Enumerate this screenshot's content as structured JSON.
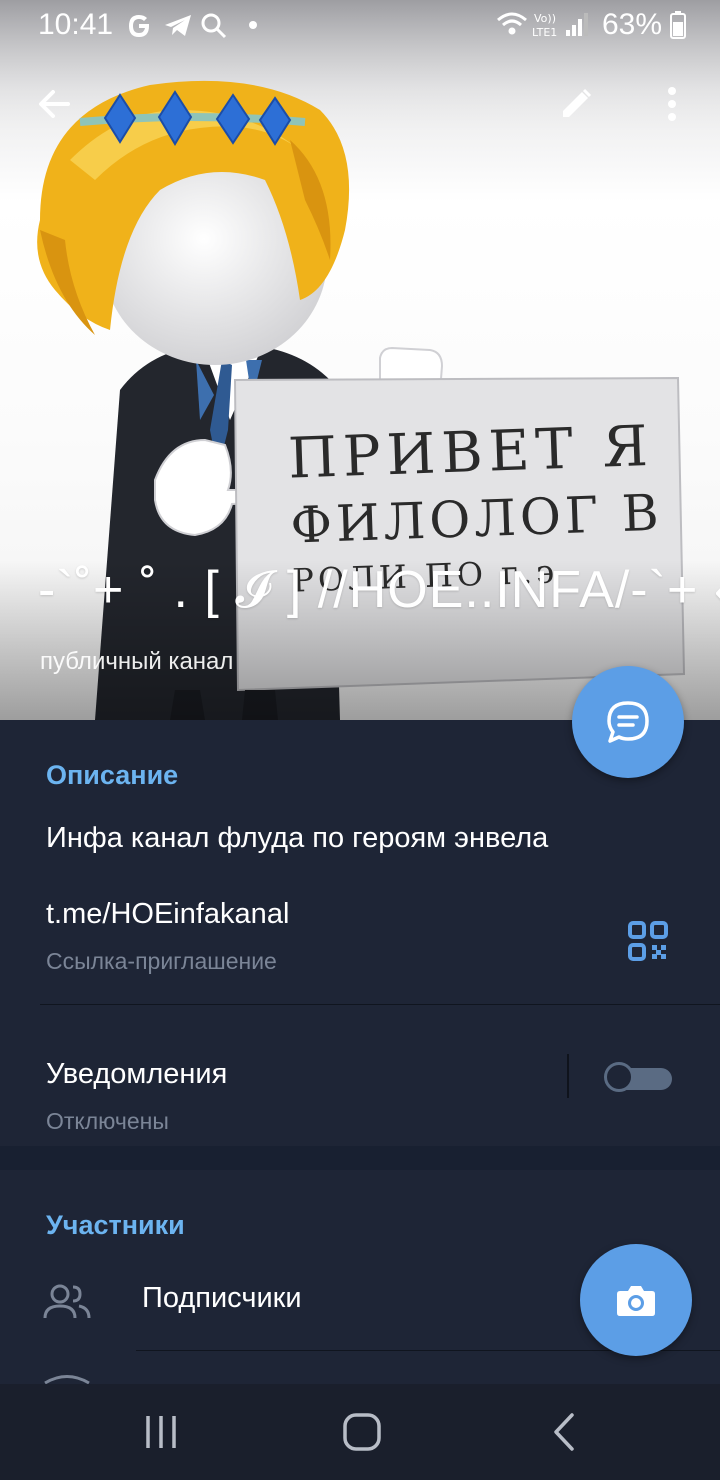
{
  "status_bar": {
    "time": "10:41",
    "battery": "63%",
    "left_icons": [
      "google-icon",
      "telegram-icon",
      "search-icon",
      "dot-icon"
    ],
    "right_icons": [
      "wifi-icon",
      "volte-icon",
      "signal-icon",
      "battery-icon"
    ]
  },
  "header": {
    "back_icon": "arrow-left-icon",
    "edit_icon": "pencil-icon",
    "more_icon": "more-vertical-icon",
    "channel_name": "-`˚+ ˚ . [ 𝓘 ] //HOE..INFA/-`+ ‹",
    "channel_type": "публичный канал",
    "poster_text": [
      "ПРИВЕТ Я",
      "ФИЛОЛОГ В",
      "РОЛИ ПО г.э"
    ]
  },
  "info": {
    "section_title": "Описание",
    "description": "Инфа канал флуда по героям энвела",
    "link": "t.me/HOEinfakanal",
    "link_caption": "Ссылка-приглашение",
    "notifications_label": "Уведомления",
    "notifications_status": "Отключены",
    "notifications_enabled": false
  },
  "members": {
    "section_title": "Участники",
    "subscribers_label": "Подписчики"
  },
  "colors": {
    "accent": "#5c9ee6",
    "section_header": "#6cb4f0",
    "panel_bg": "#1e2536",
    "page_bg": "#182031"
  },
  "navbar": {
    "icons": [
      "recent-apps-icon",
      "home-icon",
      "back-nav-icon"
    ]
  }
}
